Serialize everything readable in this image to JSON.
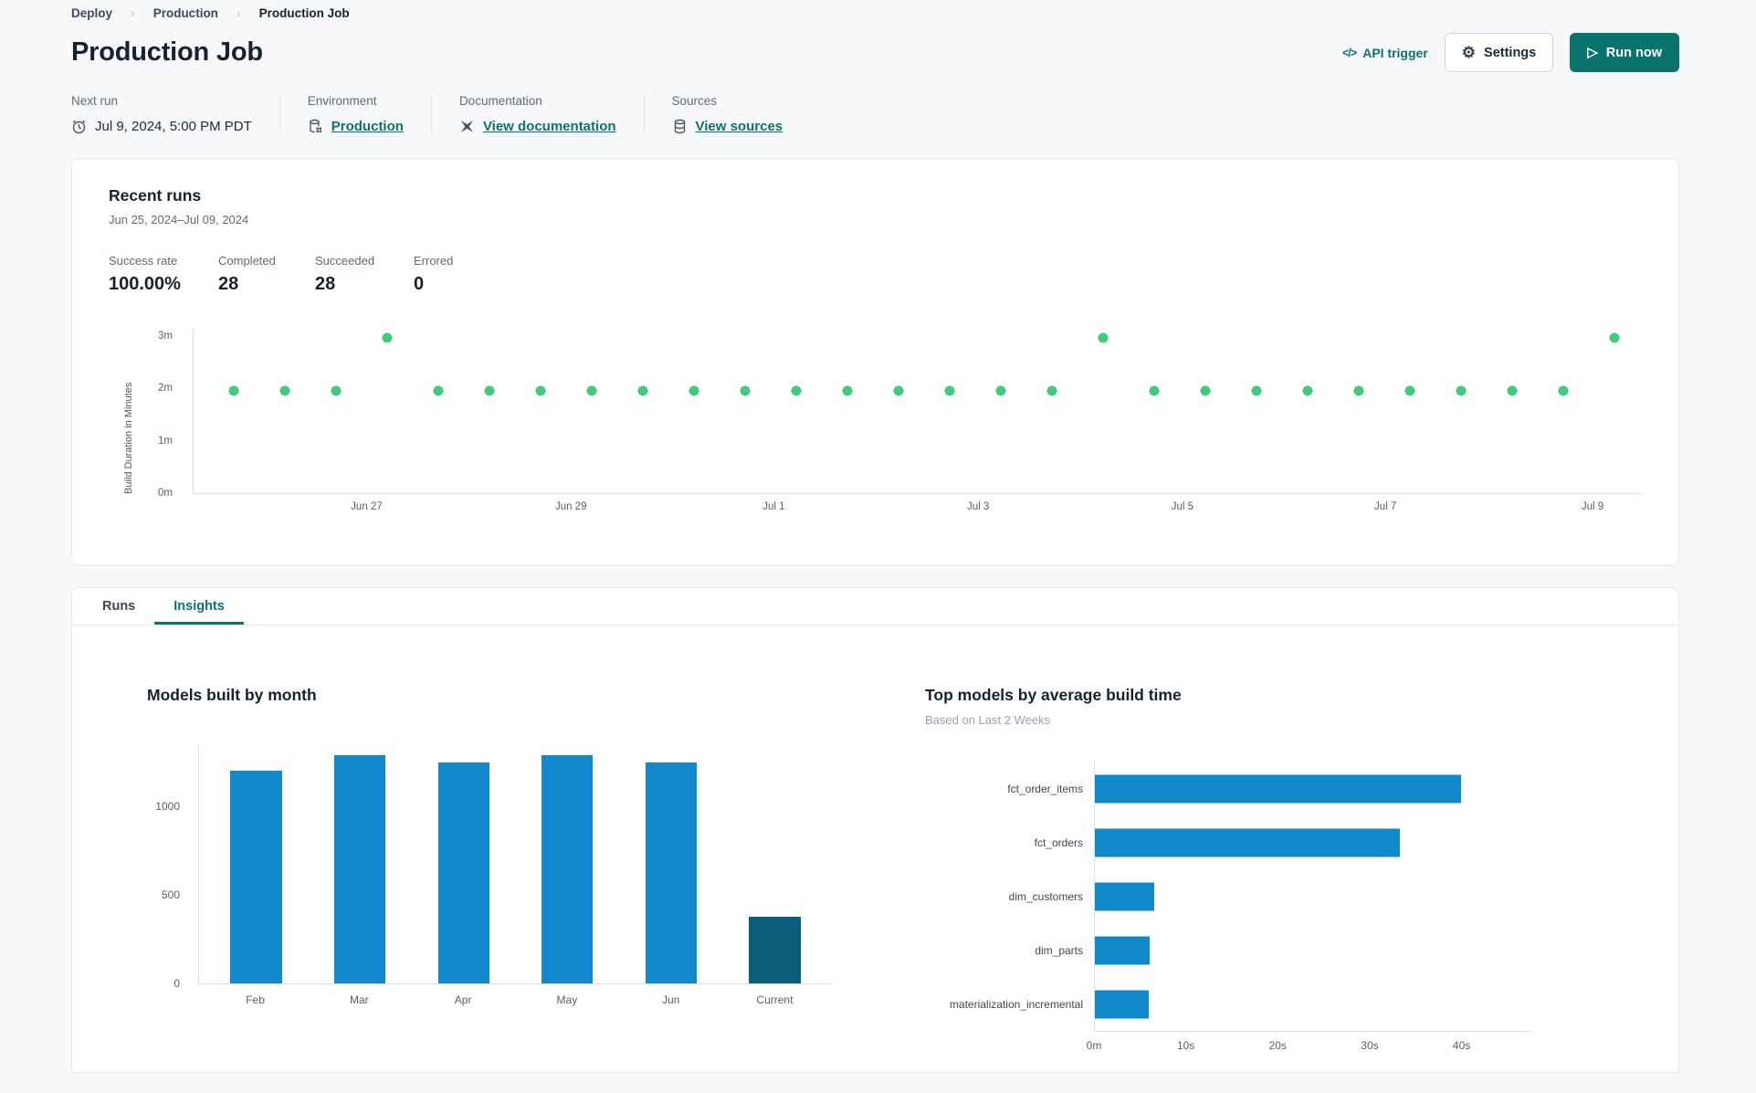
{
  "breadcrumb": {
    "items": [
      {
        "label": "Deploy"
      },
      {
        "label": "Production"
      },
      {
        "label": "Production Job"
      }
    ]
  },
  "header": {
    "title": "Production Job",
    "api_trigger_label": "API trigger",
    "settings_label": "Settings",
    "run_now_label": "Run now"
  },
  "info": {
    "columns": [
      {
        "label": "Next run",
        "value": "Jul 9, 2024, 5:00 PM PDT"
      },
      {
        "label": "Environment",
        "value": "Production"
      },
      {
        "label": "Documentation",
        "value": "View documentation"
      },
      {
        "label": "Sources",
        "value": "View sources"
      }
    ]
  },
  "recent_runs": {
    "title": "Recent runs",
    "date_range": "Jun 25, 2024–Jul 09, 2024",
    "stats": [
      {
        "label": "Success rate",
        "value": "100.00%"
      },
      {
        "label": "Completed",
        "value": "28"
      },
      {
        "label": "Succeeded",
        "value": "28"
      },
      {
        "label": "Errored",
        "value": "0"
      }
    ]
  },
  "tabs": [
    {
      "label": "Runs",
      "active": false
    },
    {
      "label": "Insights",
      "active": true
    }
  ],
  "colors": {
    "teal_accent": "#0a736e",
    "run_dot_green": "#41c97d",
    "bar_blue": "#1289ca",
    "bar_dark_blue": "#0b5d7a"
  },
  "chart_data": [
    {
      "id": "build-duration-scatter",
      "type": "scatter",
      "title": "Recent runs",
      "ylabel": "Build Duration in Minutes",
      "ylim_minutes": [
        0,
        3.15
      ],
      "yticks": [
        {
          "value": 3,
          "label": "3m"
        },
        {
          "value": 2,
          "label": "2m"
        },
        {
          "value": 1,
          "label": "1m"
        },
        {
          "value": 0,
          "label": "0m"
        }
      ],
      "xticks": [
        {
          "label": "Jun 27",
          "fraction": 0.12
        },
        {
          "label": "Jun 29",
          "fraction": 0.261
        },
        {
          "label": "Jul 1",
          "fraction": 0.401
        },
        {
          "label": "Jul 3",
          "fraction": 0.542
        },
        {
          "label": "Jul 5",
          "fraction": 0.683
        },
        {
          "label": "Jul 7",
          "fraction": 0.823
        },
        {
          "label": "Jul 9",
          "fraction": 0.966
        }
      ],
      "points_first_fraction": 0.028,
      "points_step_fraction": 0.0353,
      "durations_minutes": [
        1.95,
        1.95,
        1.95,
        2.97,
        1.95,
        1.95,
        1.95,
        1.95,
        1.95,
        1.95,
        1.95,
        1.95,
        1.95,
        1.95,
        1.95,
        1.95,
        1.95,
        2.97,
        1.95,
        1.95,
        1.95,
        1.95,
        1.95,
        1.95,
        1.95,
        1.95,
        1.95,
        2.97
      ],
      "point_color": "#41c97d",
      "grid": false
    },
    {
      "id": "models-built-by-month",
      "type": "bar",
      "title": "Models built by month",
      "categories": [
        "Feb",
        "Mar",
        "Apr",
        "May",
        "Jun",
        "Current"
      ],
      "values": [
        1203,
        1287,
        1245,
        1288,
        1246,
        374
      ],
      "bar_colors": [
        "#1289ca",
        "#1289ca",
        "#1289ca",
        "#1289ca",
        "#1289ca",
        "#0b5d7a"
      ],
      "yticks": [
        0,
        500,
        1000
      ],
      "ylim": [
        0,
        1350
      ],
      "xlabel": "",
      "ylabel": "",
      "grid": false
    },
    {
      "id": "top-models-by-average-build-time",
      "type": "bar-horizontal",
      "title": "Top models by average build time",
      "subtitle": "Based on Last 2 Weeks",
      "categories": [
        "fct_order_items",
        "fct_orders",
        "dim_customers",
        "dim_parts",
        "materialization_incremental"
      ],
      "values_seconds": [
        39.9,
        33.3,
        6.5,
        6.0,
        5.9
      ],
      "xticks": [
        {
          "value": 0,
          "label": "0m"
        },
        {
          "value": 10,
          "label": "10s"
        },
        {
          "value": 20,
          "label": "20s"
        },
        {
          "value": 30,
          "label": "30s"
        },
        {
          "value": 40,
          "label": "40s"
        }
      ],
      "xlim": [
        0,
        46
      ],
      "bar_color": "#1289ca",
      "grid": false
    }
  ]
}
